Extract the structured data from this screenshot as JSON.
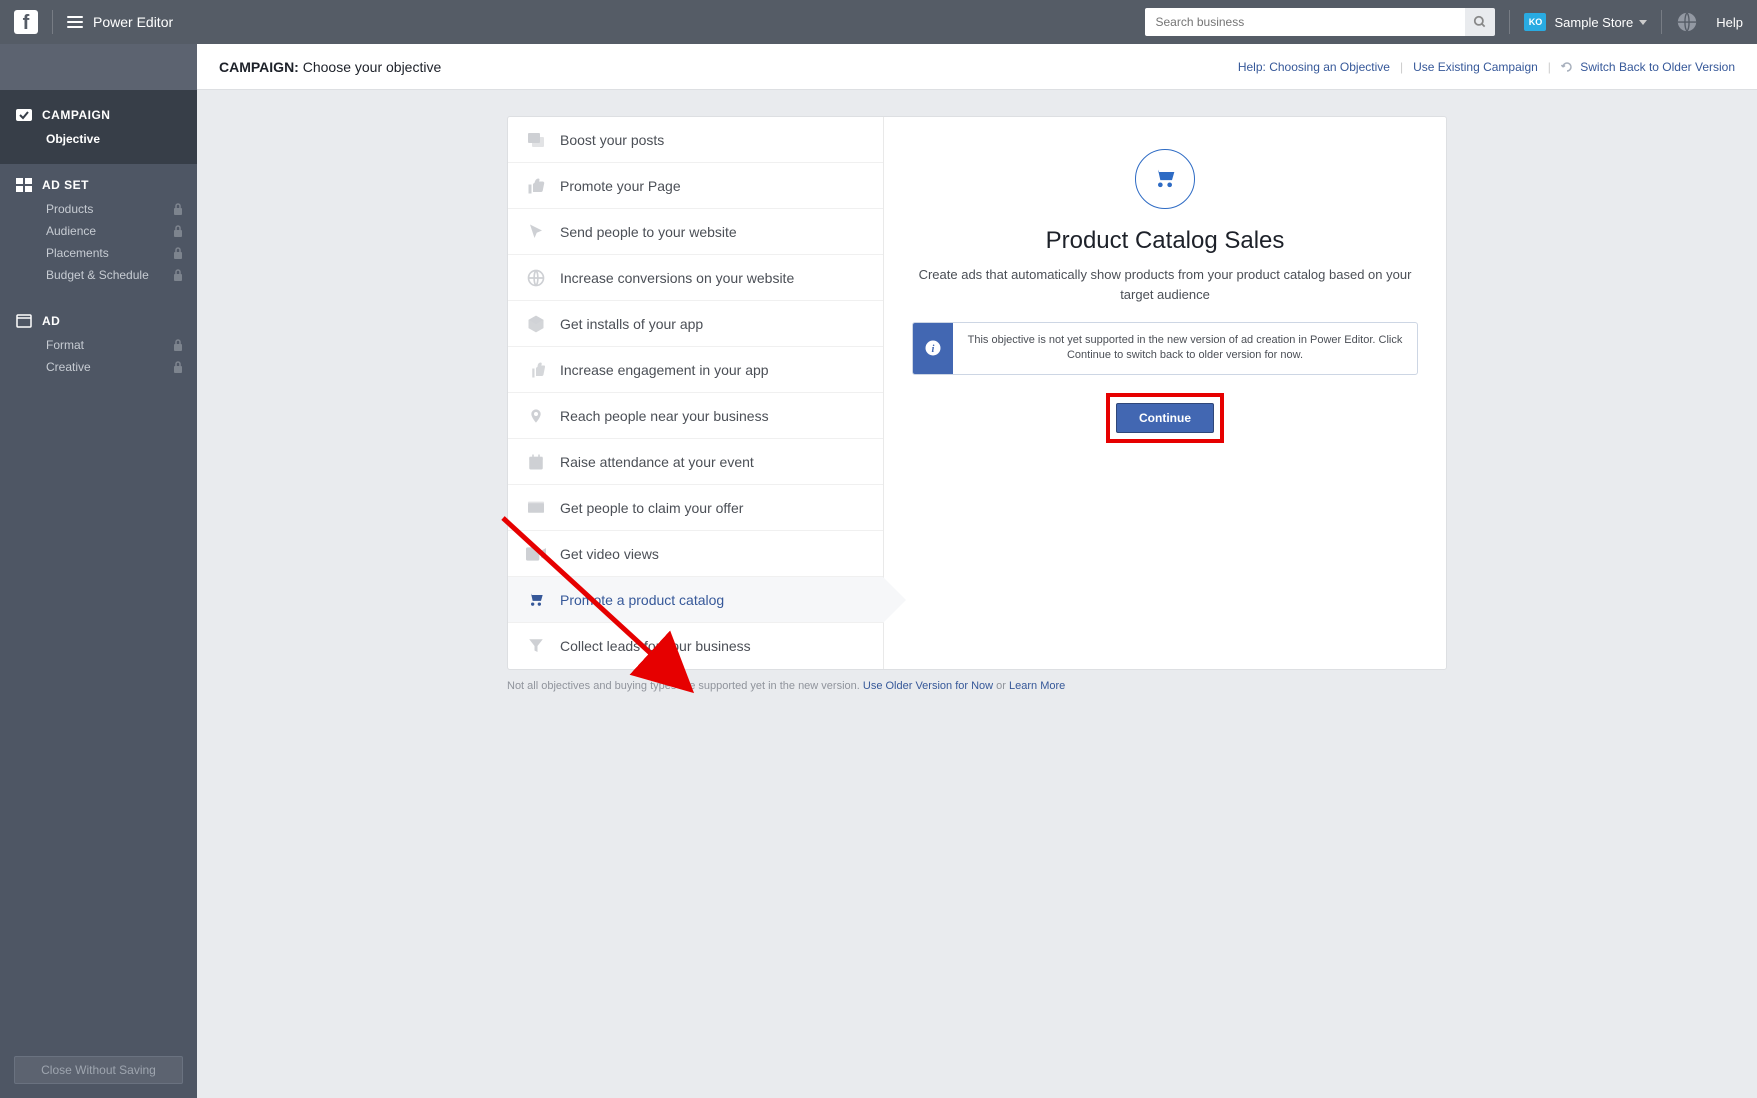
{
  "topbar": {
    "app_title": "Power Editor",
    "search_placeholder": "Search business",
    "user_badge": "KO",
    "user_name": "Sample Store",
    "help_label": "Help"
  },
  "sidebar": {
    "campaign": {
      "header": "CAMPAIGN",
      "items": [
        "Objective"
      ]
    },
    "adset": {
      "header": "AD SET",
      "items": [
        "Products",
        "Audience",
        "Placements",
        "Budget & Schedule"
      ]
    },
    "ad": {
      "header": "AD",
      "items": [
        "Format",
        "Creative"
      ]
    },
    "close_label": "Close Without Saving"
  },
  "header": {
    "title_bold": "CAMPAIGN:",
    "title_rest": " Choose your objective",
    "help_link": "Help: Choosing an Objective",
    "use_existing": "Use Existing Campaign",
    "switch_older": "Switch Back to Older Version"
  },
  "objectives": [
    {
      "icon": "posts-icon",
      "label": "Boost your posts"
    },
    {
      "icon": "like-icon",
      "label": "Promote your Page"
    },
    {
      "icon": "cursor-icon",
      "label": "Send people to your website"
    },
    {
      "icon": "globe-icon",
      "label": "Increase conversions on your website"
    },
    {
      "icon": "box-icon",
      "label": "Get installs of your app"
    },
    {
      "icon": "thumbs-icon",
      "label": "Increase engagement in your app"
    },
    {
      "icon": "pin-icon",
      "label": "Reach people near your business"
    },
    {
      "icon": "calendar-icon",
      "label": "Raise attendance at your event"
    },
    {
      "icon": "tag-icon",
      "label": "Get people to claim your offer"
    },
    {
      "icon": "video-icon",
      "label": "Get video views"
    },
    {
      "icon": "cart-icon",
      "label": "Promote a product catalog",
      "selected": true
    },
    {
      "icon": "funnel-icon",
      "label": "Collect leads for your business"
    }
  ],
  "detail": {
    "title": "Product Catalog Sales",
    "desc": "Create ads that automatically show products from your product catalog based on your target audience",
    "info_text": "This objective is not yet supported in the new version of ad creation in Power Editor. Click Continue to switch back to older version for now.",
    "continue_label": "Continue"
  },
  "footnote": {
    "text": "Not all objectives and buying types are supported yet in the new version. ",
    "link1": "Use Older Version for Now",
    "or": " or ",
    "link2": "Learn More"
  }
}
